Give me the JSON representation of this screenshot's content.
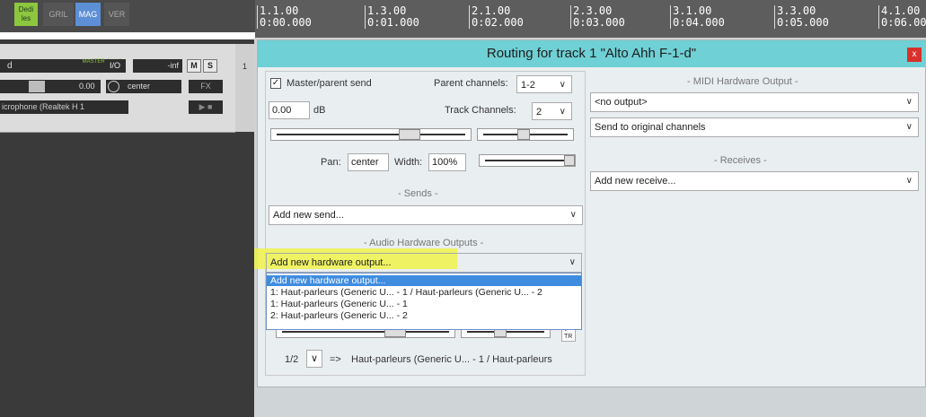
{
  "toolbar": {
    "dedi": "Dedi les",
    "grid": "GRIL",
    "mag": "MAG",
    "ver": "VER"
  },
  "timeline": {
    "markers": [
      {
        "bar": "1.1.00",
        "time": "0:00.000"
      },
      {
        "bar": "1.3.00",
        "time": "0:01.000"
      },
      {
        "bar": "2.1.00",
        "time": "0:02.000"
      },
      {
        "bar": "2.3.00",
        "time": "0:03.000"
      },
      {
        "bar": "3.1.00",
        "time": "0:04.000"
      },
      {
        "bar": "3.3.00",
        "time": "0:05.000"
      },
      {
        "bar": "4.1.00",
        "time": "0:06.00"
      }
    ]
  },
  "track": {
    "name": "d",
    "master": "MASTER CHILD",
    "io": "I/O",
    "volume": "-inf",
    "mute": "M",
    "solo": "S",
    "fader_value": "0.00",
    "pan": "center",
    "fx": "FX",
    "input": "icrophone (Realtek H 1",
    "number": "1"
  },
  "routing": {
    "title": "Routing for track 1 \"Alto Ahh F-1-d\"",
    "close": "x",
    "master_send_label": "Master/parent send",
    "parent_channels_label": "Parent channels:",
    "parent_channels_value": "1-2",
    "volume_value": "0.00",
    "volume_unit": "dB",
    "track_channels_label": "Track Channels:",
    "track_channels_value": "2",
    "pan_label": "Pan:",
    "pan_value": "center",
    "width_label": "Width:",
    "width_value": "100%",
    "sends_header": "- Sends -",
    "sends_dropdown": "Add new send...",
    "hw_header": "- Audio Hardware Outputs -",
    "hw_dropdown": "Add new hardware output...",
    "hw_options": [
      "Add new hardware output...",
      "1: Haut-parleurs (Generic U... - 1 / Haut-parleurs (Generic U... - 2",
      "1: Haut-parleurs (Generic U... - 1",
      "2: Haut-parleurs (Generic U... - 2"
    ],
    "hw_channel": "1/2",
    "hw_arrow": "=>",
    "hw_target": "Haut-parleurs (Generic U... - 1 / Haut-parleurs",
    "midi_header": "- MIDI Hardware Output -",
    "midi_output": "<no output>",
    "midi_channels": "Send to original channels",
    "receives_header": "- Receives -",
    "receives_dropdown": "Add new receive..."
  }
}
